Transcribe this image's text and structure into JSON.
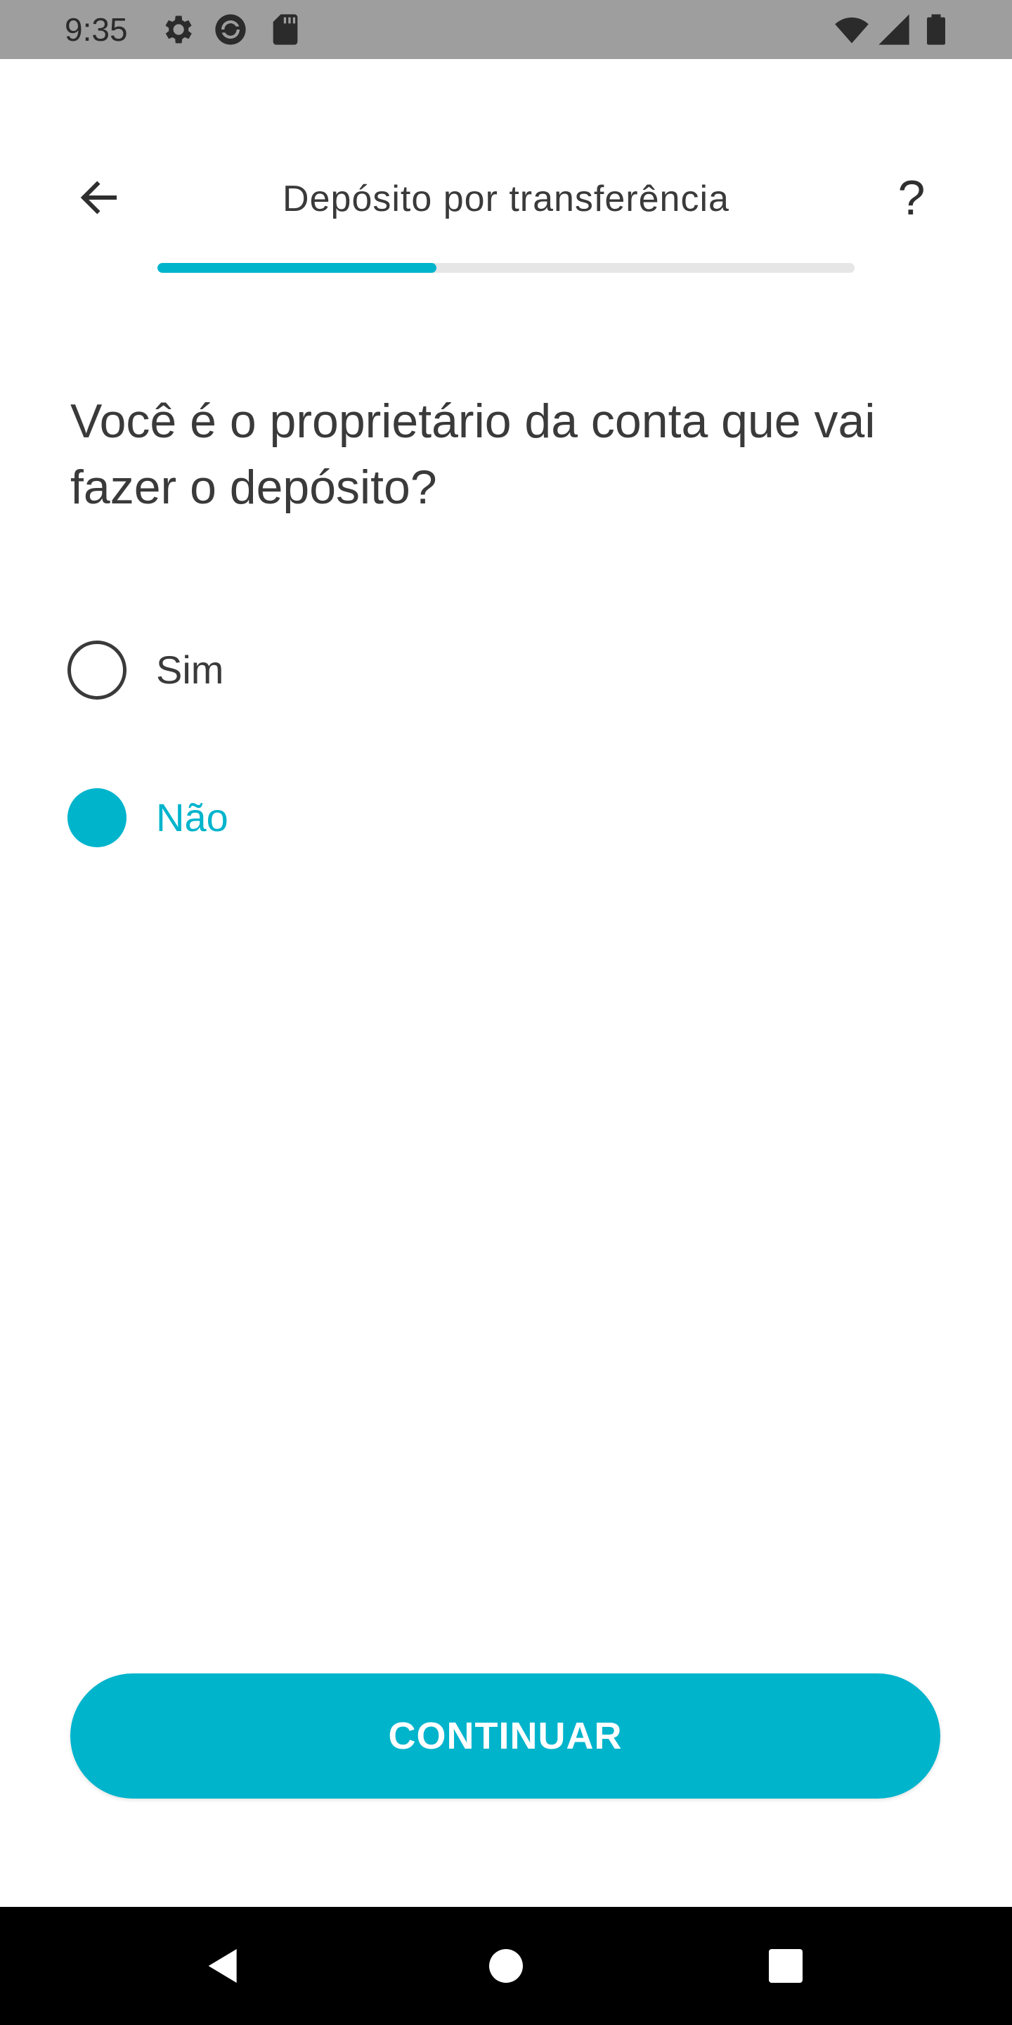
{
  "status_bar": {
    "time": "9:35",
    "icons": [
      "settings-icon",
      "sync-icon",
      "sd-card-icon",
      "wifi-icon",
      "signal-icon",
      "battery-icon"
    ]
  },
  "header": {
    "back_icon": "arrow-left-icon",
    "title": "Depósito por transferência",
    "help_label": "?"
  },
  "progress": {
    "fraction": 0.4
  },
  "question": "Você é o proprietário da conta que vai fazer o depósito?",
  "options": [
    {
      "label": "Sim",
      "selected": false
    },
    {
      "label": "Não",
      "selected": true
    }
  ],
  "continue_label": "CONTINUAR",
  "nav_bar": {
    "icons": [
      "back-triangle-icon",
      "home-circle-icon",
      "recents-square-icon"
    ]
  },
  "colors": {
    "accent": "#00b4cc",
    "status_bar": "#9e9e9e",
    "nav_bar": "#000000",
    "text": "#3a3a3a"
  }
}
